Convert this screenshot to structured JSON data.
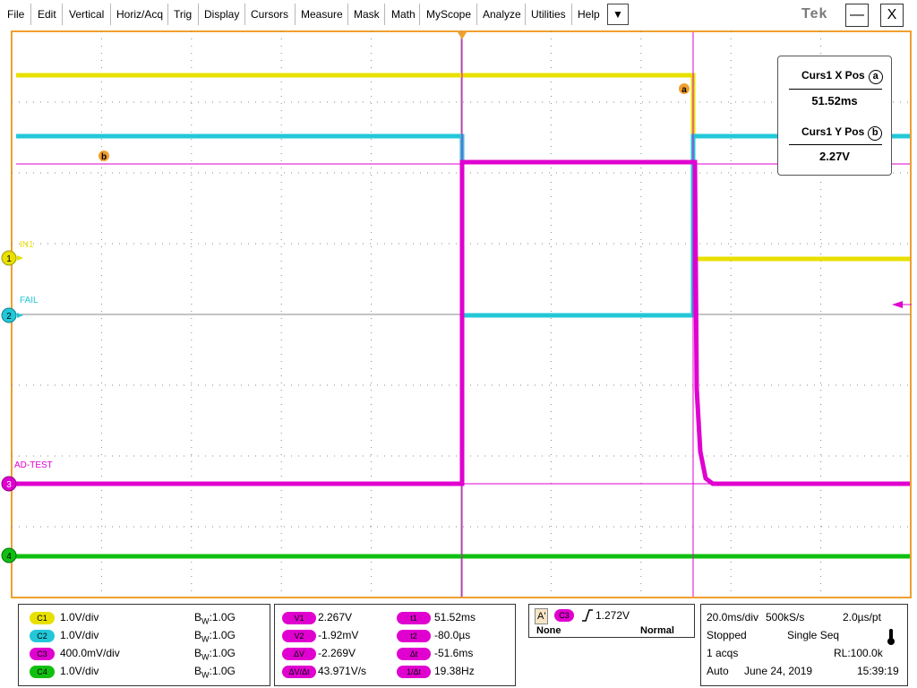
{
  "menu": {
    "items": [
      "File",
      "Edit",
      "Vertical",
      "Horiz/Acq",
      "Trig",
      "Display",
      "Cursors",
      "Measure",
      "Mask",
      "Math",
      "MyScope",
      "Analyze",
      "Utilities",
      "Help"
    ],
    "dropdown_glyph": "▼",
    "logo": "Tek",
    "minimize": "—",
    "close": "X"
  },
  "traces": {
    "ch1_label": "IN1",
    "ch2_label": "FAIL",
    "ch3_label": "AD-TEST",
    "markers": [
      "1",
      "2",
      "3",
      "4"
    ],
    "cursor_a": "a",
    "cursor_b": "b"
  },
  "colors": {
    "ch1": "#e8e000",
    "ch2": "#22c8d8",
    "ch3": "#e000d0",
    "ch4": "#10c010",
    "frame": "#f0a030",
    "grid": "#8a8a8a"
  },
  "readout": {
    "x_title": "Curs1 X Pos",
    "x_symbol": "a",
    "x_value": "51.52ms",
    "y_title": "Curs1 Y Pos",
    "y_symbol": "b",
    "y_value": "2.27V"
  },
  "channels": [
    {
      "badge": "C1",
      "scale": "1.0V/div",
      "bw": "1.0G"
    },
    {
      "badge": "C2",
      "scale": "1.0V/div",
      "bw": "1.0G"
    },
    {
      "badge": "C3",
      "scale": "400.0mV/div",
      "bw": "1.0G"
    },
    {
      "badge": "C4",
      "scale": "1.0V/div",
      "bw": "1.0G"
    }
  ],
  "bw_prefix": "B",
  "bw_sub": "W",
  "cursors": {
    "left": [
      {
        "badge": "V1",
        "value": "2.267V"
      },
      {
        "badge": "V2",
        "value": "-1.92mV"
      },
      {
        "badge": "ΔV",
        "value": "-2.269V"
      },
      {
        "badge": "ΔV/Δt",
        "value": "43.971V/s"
      }
    ],
    "right": [
      {
        "badge": "t1",
        "value": "51.52ms"
      },
      {
        "badge": "t2",
        "value": "-80.0µs"
      },
      {
        "badge": "Δt",
        "value": "-51.6ms"
      },
      {
        "badge": "1/Δt",
        "value": "19.38Hz"
      }
    ]
  },
  "trigger": {
    "source_a": "A'",
    "source_ch": "C3",
    "level": "1.272V",
    "coupling": "None",
    "mode": "Normal"
  },
  "acquisition": {
    "timebase": "20.0ms/div",
    "sample_rate": "500kS/s",
    "resolution": "2.0µs/pt",
    "state": "Stopped",
    "seq": "Single Seq",
    "acqs": "1 acqs",
    "record_length": "RL:100.0k",
    "mode": "Auto",
    "date": "June 24, 2019",
    "time": "15:39:19"
  }
}
